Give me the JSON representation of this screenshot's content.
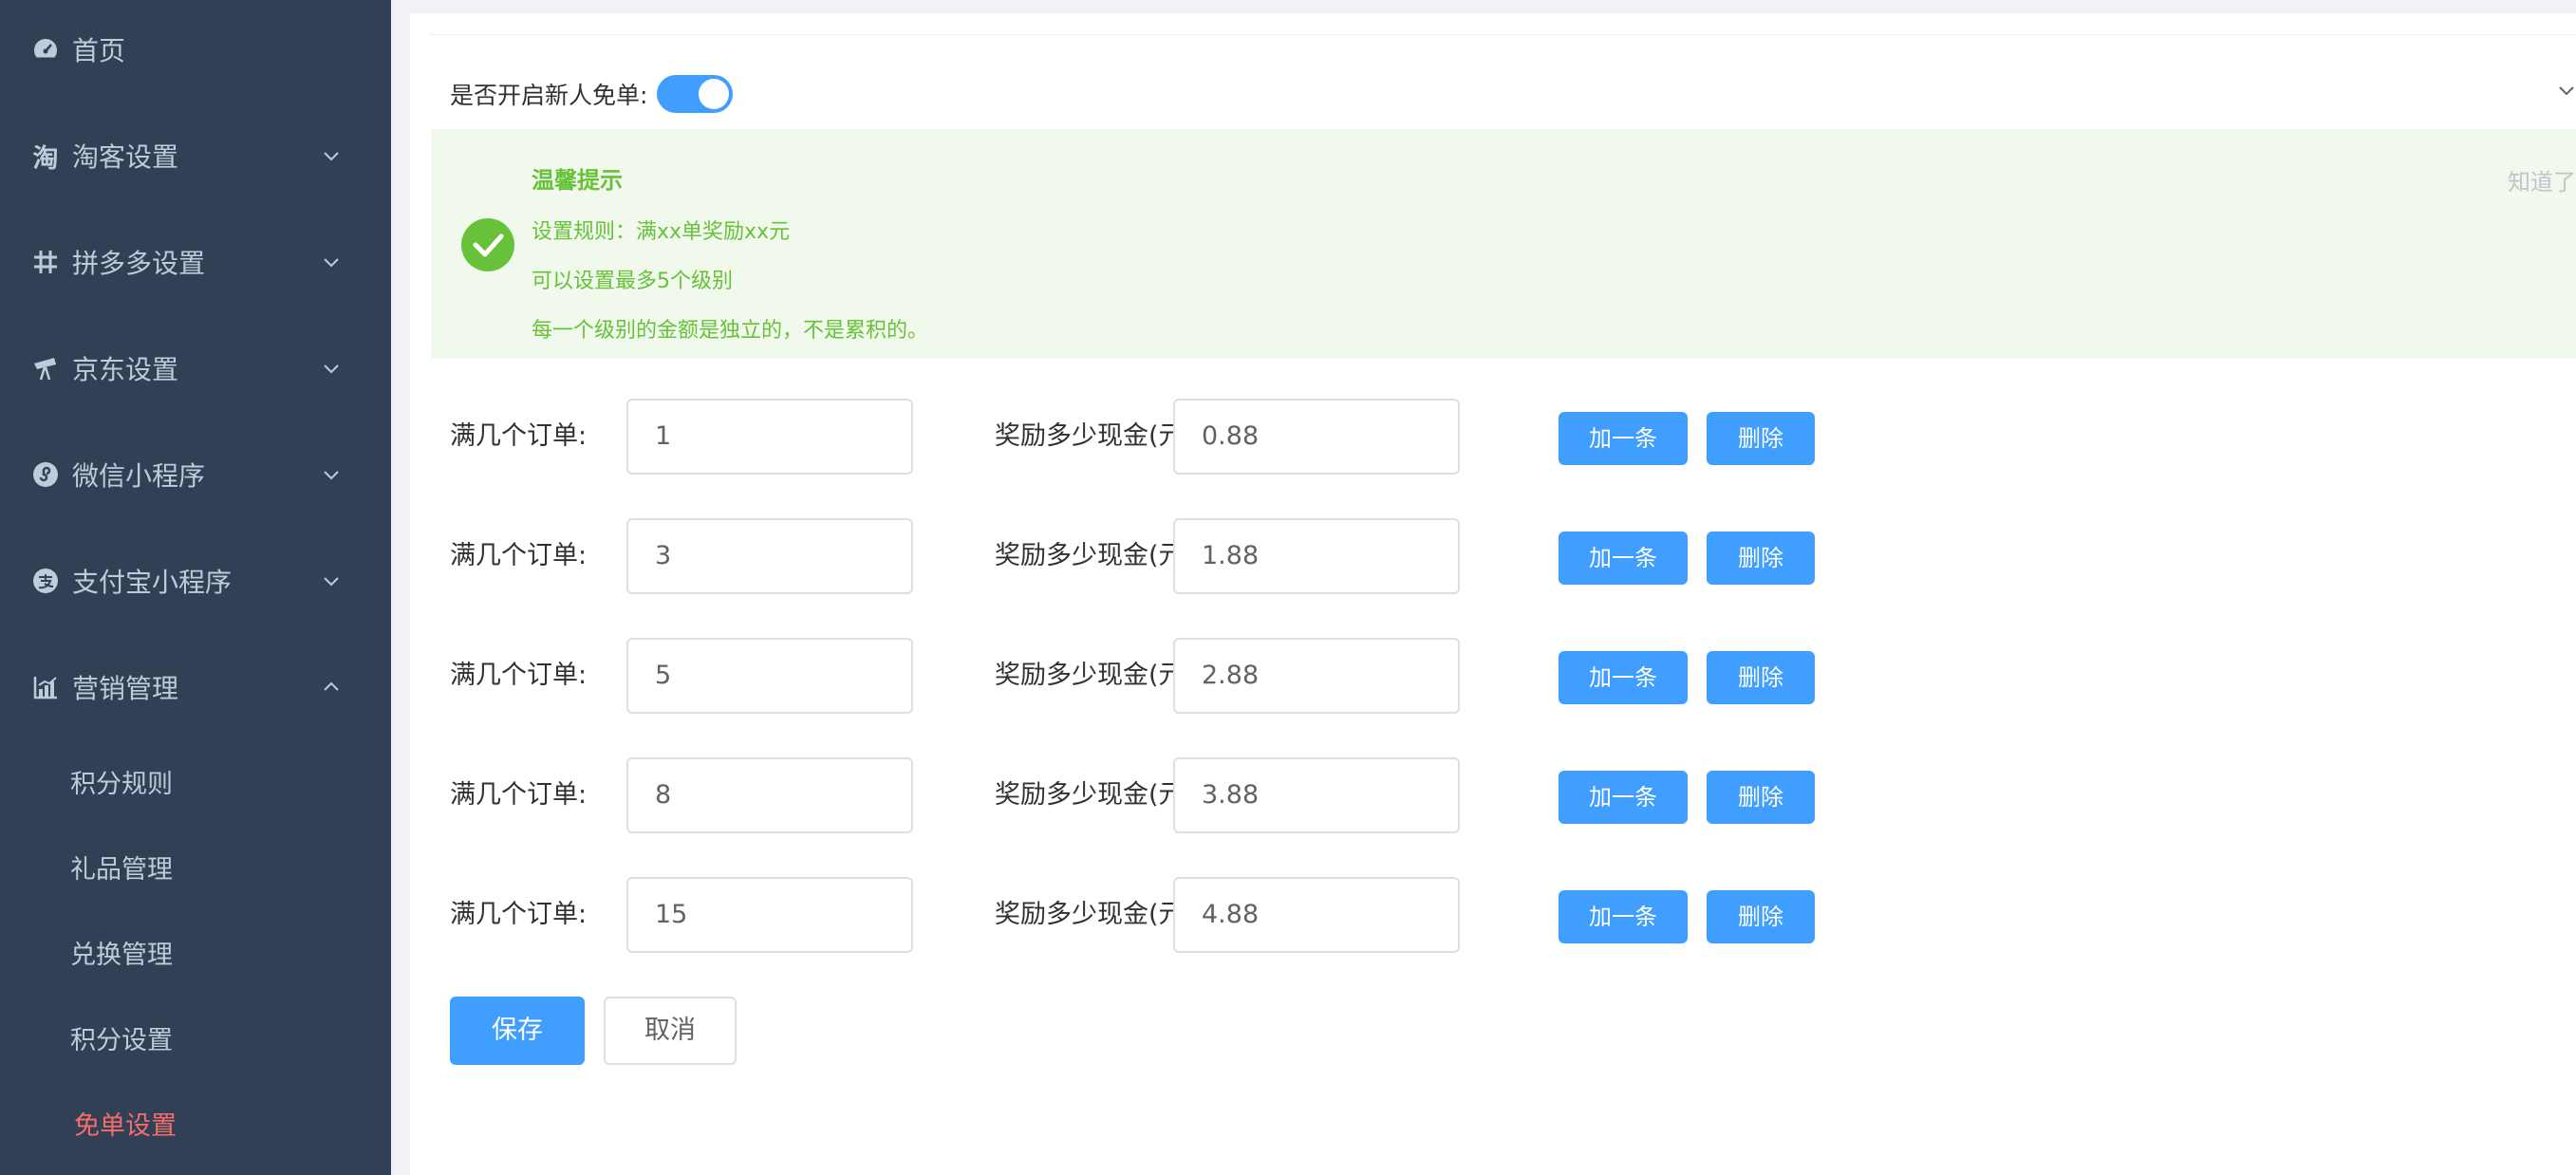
{
  "sidebar": {
    "menu": [
      {
        "label": "首页",
        "icon": "dashboard-icon"
      },
      {
        "label": "淘客设置",
        "icon": "taobao-icon"
      },
      {
        "label": "拼多多设置",
        "icon": "grid-icon"
      },
      {
        "label": "京东设置",
        "icon": "telescope-icon"
      },
      {
        "label": "微信小程序",
        "icon": "mini-program-icon"
      },
      {
        "label": "支付宝小程序",
        "icon": "alipay-icon"
      },
      {
        "label": "营销管理",
        "icon": "chart-icon"
      }
    ],
    "submenu": [
      {
        "label": "积分规则"
      },
      {
        "label": "礼品管理"
      },
      {
        "label": "兑换管理"
      },
      {
        "label": "积分设置"
      },
      {
        "label": "免单设置"
      }
    ],
    "active_color": "#f56c6c",
    "bg_color": "#304156"
  },
  "toggle": {
    "label": "是否开启新人免单:",
    "enabled": true,
    "color": "#409eff"
  },
  "alert": {
    "title": "温馨提示",
    "lines": [
      "设置规则：满xx单奖励xx元",
      "可以设置最多5个级别",
      "每一个级别的金额是独立的，不是累积的。"
    ],
    "close_text": "知道了",
    "color": "#67c23a",
    "bg_color": "#f0f9eb"
  },
  "rows": [
    {
      "orders_label": "满几个订单:",
      "orders": "1",
      "reward_label": "奖励多少现金(元):",
      "reward": "0.88",
      "add_label": "加一条",
      "delete_label": "删除"
    },
    {
      "orders_label": "满几个订单:",
      "orders": "3",
      "reward_label": "奖励多少现金(元):",
      "reward": "1.88",
      "add_label": "加一条",
      "delete_label": "删除"
    },
    {
      "orders_label": "满几个订单:",
      "orders": "5",
      "reward_label": "奖励多少现金(元):",
      "reward": "2.88",
      "add_label": "加一条",
      "delete_label": "删除"
    },
    {
      "orders_label": "满几个订单:",
      "orders": "8",
      "reward_label": "奖励多少现金(元):",
      "reward": "3.88",
      "add_label": "加一条",
      "delete_label": "删除"
    },
    {
      "orders_label": "满几个订单:",
      "orders": "15",
      "reward_label": "奖励多少现金(元):",
      "reward": "4.88",
      "add_label": "加一条",
      "delete_label": "删除"
    }
  ],
  "actions": {
    "save_label": "保存",
    "cancel_label": "取消"
  },
  "primary_color": "#409eff"
}
